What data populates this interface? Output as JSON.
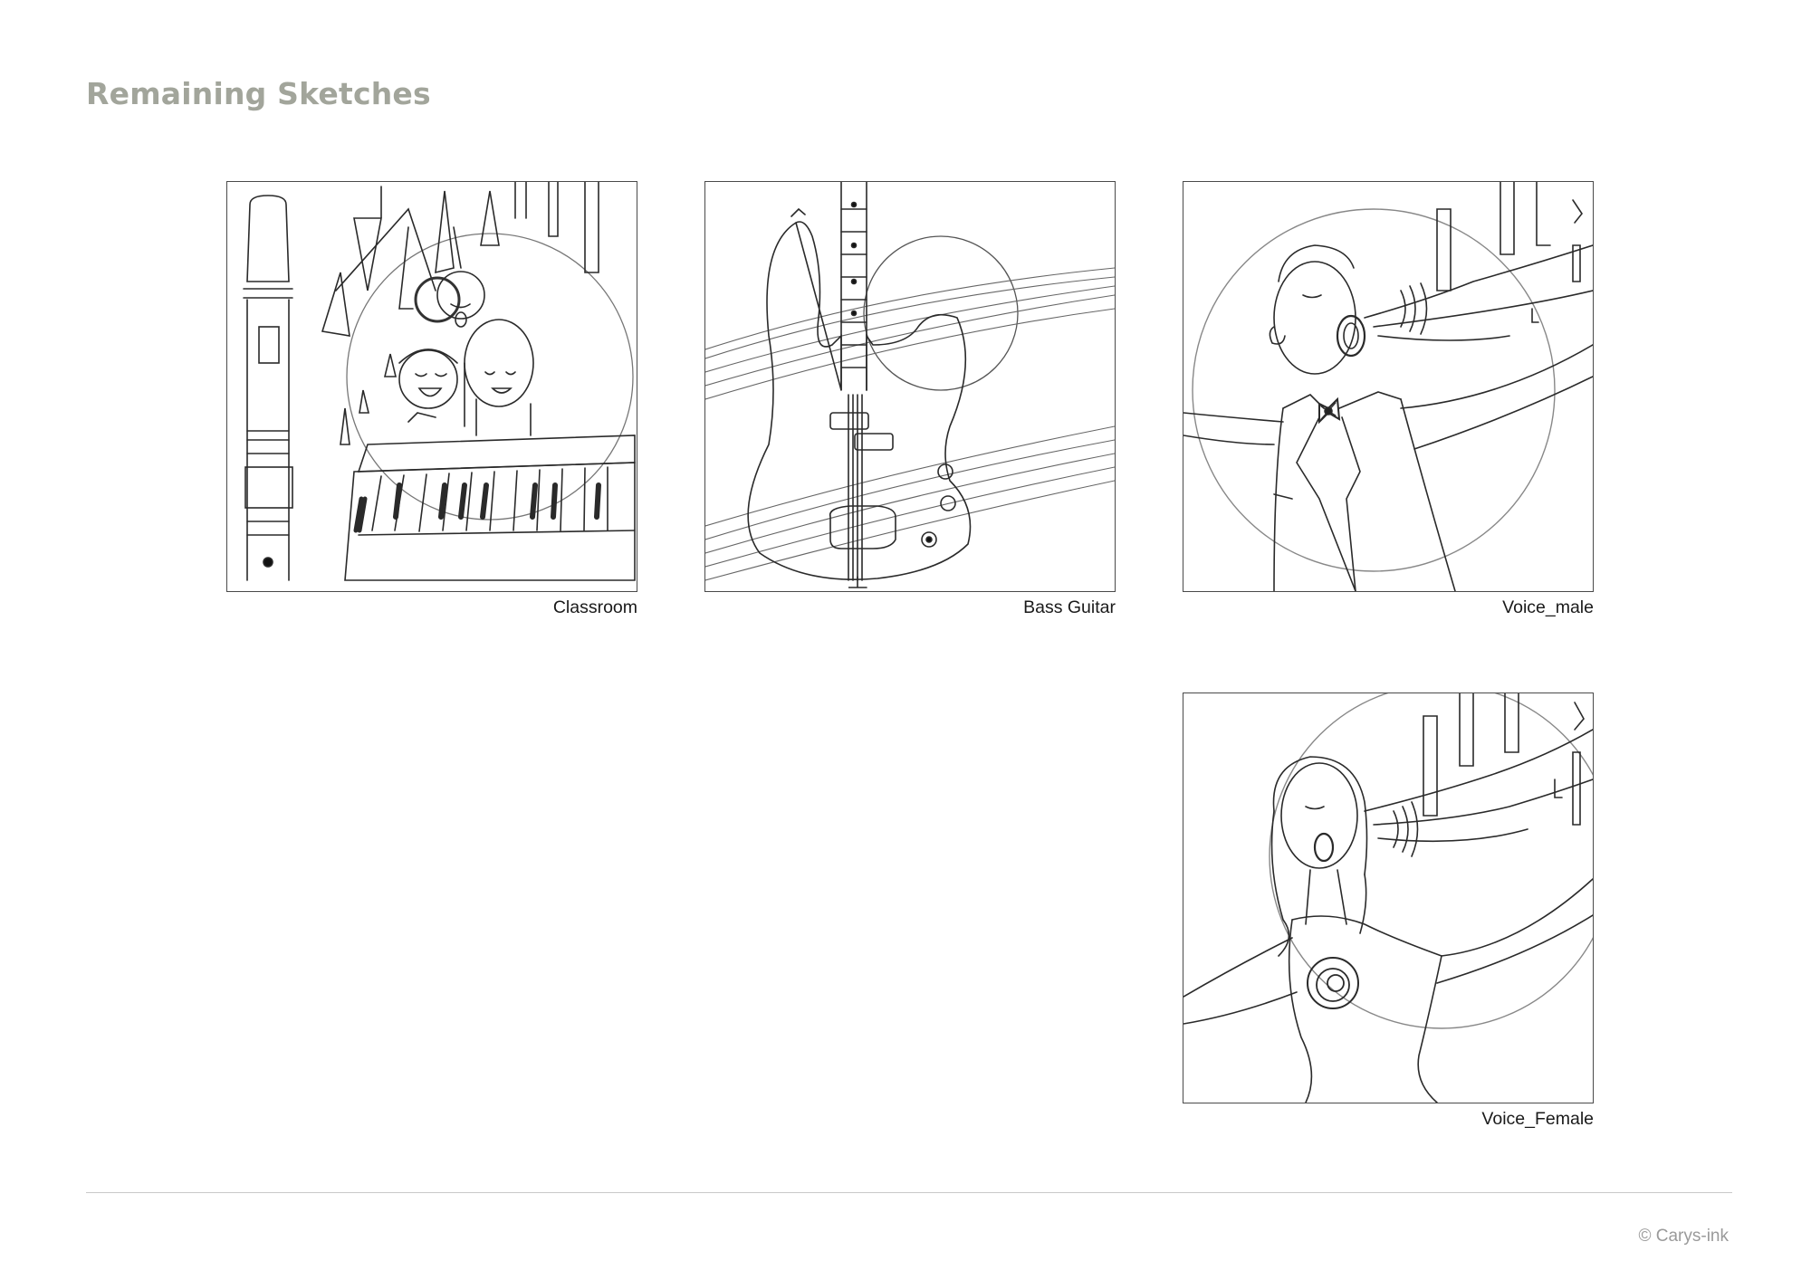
{
  "page": {
    "title": "Remaining Sketches"
  },
  "sketches": [
    {
      "caption": "Classroom"
    },
    {
      "caption": "Bass Guitar"
    },
    {
      "caption": "Voice_male"
    },
    {
      "caption": "Voice_Female"
    }
  ],
  "footer": {
    "copyright": "© Carys-ink"
  }
}
